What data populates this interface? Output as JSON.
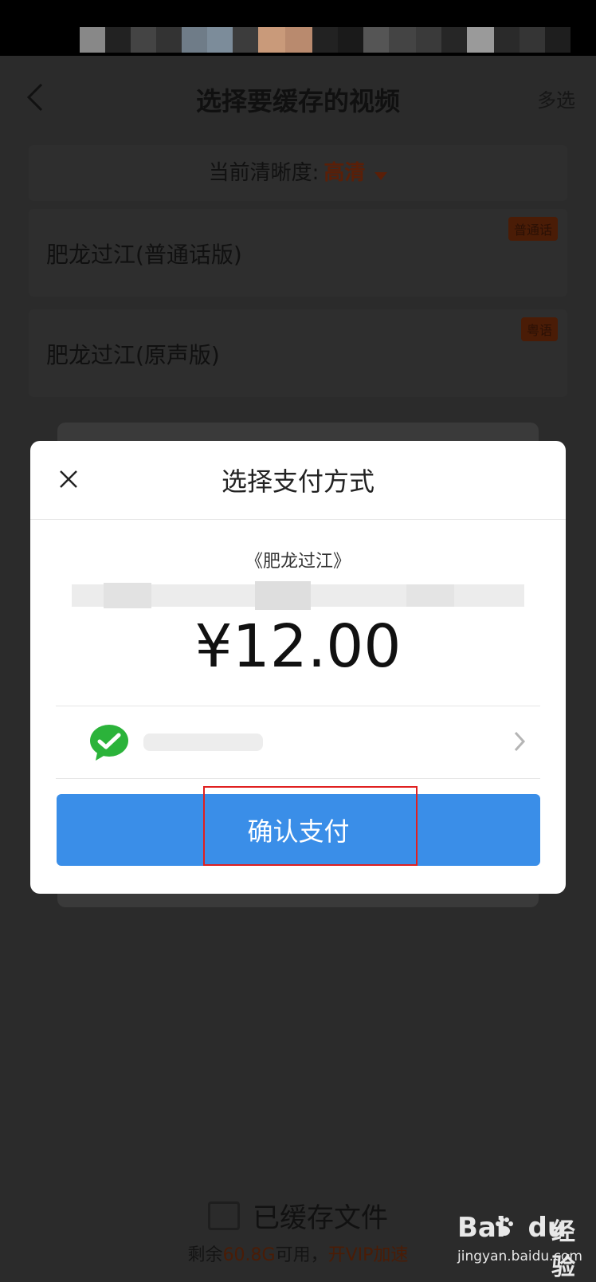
{
  "header": {
    "title": "选择要缓存的视频",
    "multi_select": "多选"
  },
  "quality": {
    "label": "当前清晰度:",
    "value": "高清"
  },
  "versions": [
    {
      "title": "肥龙过江(普通话版)",
      "badge": "普通话"
    },
    {
      "title": "肥龙过江(原声版)",
      "badge": "粤语"
    }
  ],
  "footer": {
    "cached_label": "已缓存文件",
    "storage_prefix": "剩余",
    "storage_amount": "60.8G",
    "storage_mid": "可用，",
    "vip_link": "开VIP加速"
  },
  "watermark": {
    "logo": "Bai",
    "logo_suffix": "du",
    "word": "经验",
    "url": "jingyan.baidu.com"
  },
  "dialog": {
    "title": "选择支付方式",
    "movie": "《肥龙过江》",
    "price": "¥12.00",
    "payment_method_icon": "wechat-pay-icon",
    "confirm_label": "确认支付"
  },
  "colors": {
    "accent_orange": "#e0551a",
    "button_blue": "#3a8ee8",
    "highlight_red": "#e02020",
    "wechat_green": "#2bb33a"
  }
}
